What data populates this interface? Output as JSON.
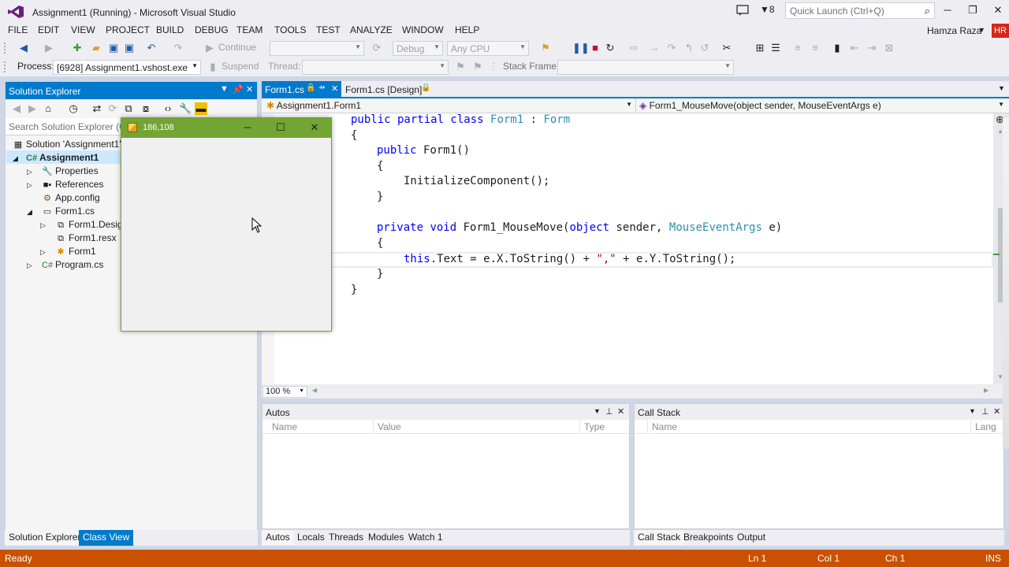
{
  "window": {
    "title": "Assignment1 (Running) - Microsoft Visual Studio",
    "notification_count": "8",
    "quick_launch_placeholder": "Quick Launch (Ctrl+Q)",
    "minimize": "─",
    "restore": "❐",
    "close": "✕"
  },
  "menu": {
    "items": [
      "FILE",
      "EDIT",
      "VIEW",
      "PROJECT",
      "BUILD",
      "DEBUG",
      "TEAM",
      "TOOLS",
      "TEST",
      "ANALYZE",
      "WINDOW",
      "HELP"
    ],
    "user": "Hamza Raza",
    "user_initials": "HR"
  },
  "toolbar": {
    "continue_label": "Continue",
    "config_value": "Debug",
    "platform_value": "Any CPU",
    "process_label": "Process:",
    "process_value": "[6928] Assignment1.vshost.exe",
    "suspend_label": "Suspend",
    "thread_label": "Thread:",
    "stack_frame_label": "Stack Frame:"
  },
  "solution_explorer": {
    "title": "Solution Explorer",
    "search_placeholder": "Search Solution Explorer (Ctrl+;)",
    "tree": [
      {
        "label": "Solution 'Assignment1' (1 project)",
        "icon": "solution-icon"
      },
      {
        "label": "Assignment1",
        "icon": "csharp-project-icon"
      },
      {
        "label": "Properties",
        "icon": "wrench-icon"
      },
      {
        "label": "References",
        "icon": "references-icon"
      },
      {
        "label": "App.config",
        "icon": "config-file-icon"
      },
      {
        "label": "Form1.cs",
        "icon": "form-icon"
      },
      {
        "label": "Form1.Designer.cs",
        "icon": "code-file-icon"
      },
      {
        "label": "Form1.resx",
        "icon": "resource-file-icon"
      },
      {
        "label": "Form1",
        "icon": "class-icon"
      },
      {
        "label": "Program.cs",
        "icon": "csharp-file-icon"
      }
    ],
    "tabs": [
      "Solution Explorer",
      "Class View"
    ]
  },
  "editor": {
    "tabs": [
      {
        "label": "Form1.cs",
        "active": true
      },
      {
        "label": "Form1.cs [Design]",
        "active": false
      }
    ],
    "nav_left": "Assignment1.Form1",
    "nav_right": "Form1_MouseMove(object sender, MouseEventArgs e)",
    "zoom": "100 %",
    "code": {
      "l1_kw": "public partial class ",
      "l1_ty": "Form1",
      "l1_mid": " : ",
      "l1_ty2": "Form",
      "l2": "{",
      "l3_kw": "public ",
      "l3_rest": "Form1()",
      "l4": "{",
      "l5": "InitializeComponent();",
      "l6": "}",
      "l7_kw1": "private ",
      "l7_kw2": "void ",
      "l7_name": "Form1_MouseMove(",
      "l7_kw3": "object ",
      "l7_p1": "sender, ",
      "l7_ty": "MouseEventArgs",
      "l7_p2": " e)",
      "l8": "{",
      "l9_kw": "this",
      "l9_a": ".Text = e.X.ToString() + ",
      "l9_str": "\",\"",
      "l9_b": " + e.Y.ToString();",
      "l10": "}",
      "l11": "}"
    }
  },
  "autos": {
    "title": "Autos",
    "columns": [
      "Name",
      "Value",
      "Type"
    ],
    "tabs": [
      "Autos",
      "Locals",
      "Threads",
      "Modules",
      "Watch 1"
    ]
  },
  "call_stack": {
    "title": "Call Stack",
    "columns": [
      "Name",
      "Lang"
    ],
    "tabs": [
      "Call Stack",
      "Breakpoints",
      "Output"
    ]
  },
  "running_form": {
    "title": "186,108",
    "minimize": "─",
    "maximize": "☐",
    "close": "✕"
  },
  "status": {
    "state": "Ready",
    "line": "Ln 1",
    "col": "Col 1",
    "ch": "Ch 1",
    "mode": "INS"
  },
  "colors": {
    "accent": "#007acc",
    "status_bar": "#ca5100",
    "keyword": "#0000ff",
    "type": "#2b91af"
  }
}
